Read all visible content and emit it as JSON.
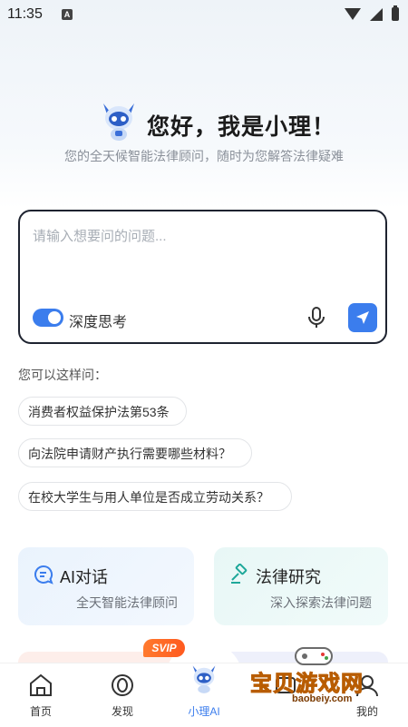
{
  "status_bar": {
    "time": "11:35",
    "notif_icon": "A"
  },
  "hero": {
    "title": "您好，我是小理！",
    "subtitle": "您的全天候智能法律顾问，随时为您解答法律疑难"
  },
  "input": {
    "placeholder": "请输入想要问的问题...",
    "deep_think_label": "深度思考",
    "deep_think_enabled": true
  },
  "suggestions": {
    "title": "您可以这样问：",
    "items": [
      "消费者权益保护法第53条",
      "向法院申请财产执行需要哪些材料？",
      "在校大学生与用人单位是否成立劳动关系？"
    ]
  },
  "cards": [
    {
      "title": "AI对话",
      "subtitle": "全天智能法律顾问",
      "icon": "chat-icon"
    },
    {
      "title": "法律研究",
      "subtitle": "深入探索法律问题",
      "icon": "gavel-icon"
    }
  ],
  "tabs": [
    {
      "label": "首页",
      "icon": "home-icon"
    },
    {
      "label": "发现",
      "icon": "discover-icon"
    },
    {
      "label": "小理AI",
      "icon": "mascot-icon"
    },
    {
      "label": "",
      "icon": "lecture-icon"
    },
    {
      "label": "我的",
      "icon": "profile-icon"
    }
  ],
  "vip_badge": "SVIP",
  "watermark": {
    "text": "宝贝游戏网",
    "url": "baobeiy.com"
  },
  "colors": {
    "accent": "#3b7ded",
    "border": "#1e2330"
  }
}
